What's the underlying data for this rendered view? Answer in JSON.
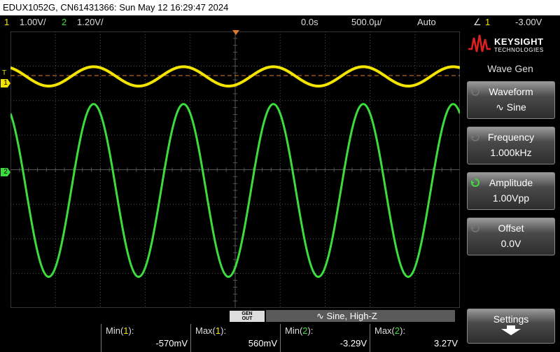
{
  "title_bar": {
    "text": "EDUX1052G, CN61431366: Sun May 12 16:29:47 2024"
  },
  "status": {
    "ch1_num": "1",
    "ch1_scale": "1.00V/",
    "ch2_num": "2",
    "ch2_scale": "1.20V/",
    "time_delay": "0.0s",
    "time_scale": "500.0µ/",
    "trigger_mode": "Auto",
    "trigger_slope": "∠",
    "trigger_source": "1",
    "trigger_level": "-3.00V"
  },
  "markers": {
    "trigger": "T",
    "ch1": "1",
    "ch2": "2"
  },
  "sidebar": {
    "logo_line1": "KEYSIGHT",
    "logo_line2": "TECHNOLOGIES",
    "menu_title": "Wave Gen",
    "softkeys": [
      {
        "label": "Waveform",
        "value": "∿ Sine"
      },
      {
        "label": "Frequency",
        "value": "1.000kHz"
      },
      {
        "label": "Amplitude",
        "value": "1.00Vpp"
      },
      {
        "label": "Offset",
        "value": "0.0V"
      },
      {
        "label": "Settings",
        "value": "🠗"
      }
    ]
  },
  "gen": {
    "badge_line1": "GEN",
    "badge_line2": "OUT",
    "status": "∿  Sine, High-Z"
  },
  "measurements": [
    {
      "label_prefix": "Min(",
      "label_ch": "1",
      "label_suffix": "):",
      "value": "-570mV"
    },
    {
      "label_prefix": "Max(",
      "label_ch": "1",
      "label_suffix": "):",
      "value": "560mV"
    },
    {
      "label_prefix": "Min(",
      "label_ch": "2",
      "label_suffix": "):",
      "value": "-3.29V"
    },
    {
      "label_prefix": "Max(",
      "label_ch": "2",
      "label_suffix": "):",
      "value": "3.27V"
    }
  ],
  "colors": {
    "ch1": "#f3e400",
    "ch2": "#3ddc3d",
    "trigger_line": "#e07a2a",
    "grid": "#555555"
  },
  "waveforms": {
    "ch1": {
      "shape": "sine",
      "period_divisions": 2.0,
      "center_div_from_top": 1.3,
      "amplitude_div": 0.28
    },
    "ch2": {
      "shape": "sine",
      "period_divisions": 2.0,
      "center_div_from_top": 4.6,
      "amplitude_div": 2.5
    }
  }
}
